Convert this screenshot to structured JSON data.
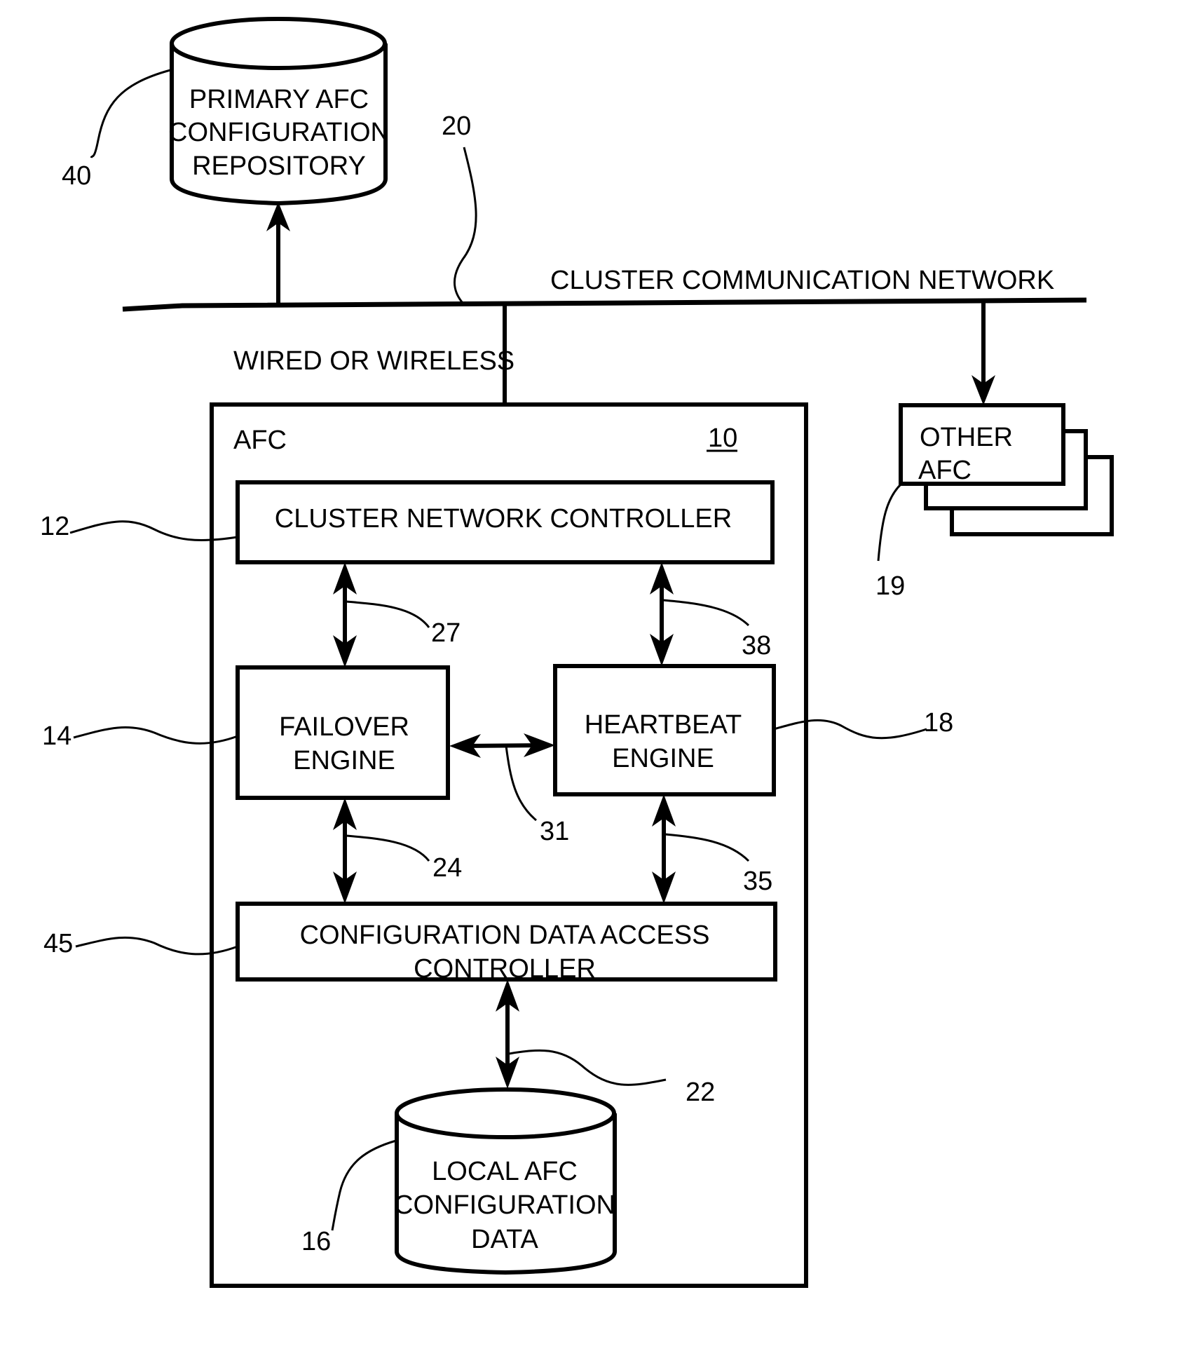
{
  "figure": {
    "network": {
      "label": "CLUSTER COMMUNICATION NETWORK",
      "ref": "20",
      "link_label": "WIRED OR WIRELESS"
    },
    "primary_repository": {
      "lines": [
        "PRIMARY AFC",
        "CONFIGURATION",
        "REPOSITORY"
      ],
      "ref": "40"
    },
    "afc": {
      "label": "AFC",
      "ref": "10",
      "cluster_network_controller": {
        "label": "CLUSTER NETWORK CONTROLLER",
        "ref": "12"
      },
      "failover_engine": {
        "lines": [
          "FAILOVER",
          "ENGINE"
        ],
        "ref": "14"
      },
      "heartbeat_engine": {
        "lines": [
          "HEARTBEAT",
          "ENGINE"
        ],
        "ref": "18"
      },
      "config_access_controller": {
        "lines": [
          "CONFIGURATION DATA ACCESS",
          "CONTROLLER"
        ],
        "ref": "45"
      },
      "local_config": {
        "lines": [
          "LOCAL AFC",
          "CONFIGURATION",
          "DATA"
        ],
        "ref": "16"
      },
      "links": {
        "cnc_failover": "27",
        "cnc_heartbeat": "38",
        "failover_heartbeat": "31",
        "failover_cdac": "24",
        "heartbeat_cdac": "35",
        "cdac_local": "22"
      }
    },
    "other_afc": {
      "lines": [
        "OTHER",
        "AFC"
      ],
      "ref": "19"
    }
  }
}
